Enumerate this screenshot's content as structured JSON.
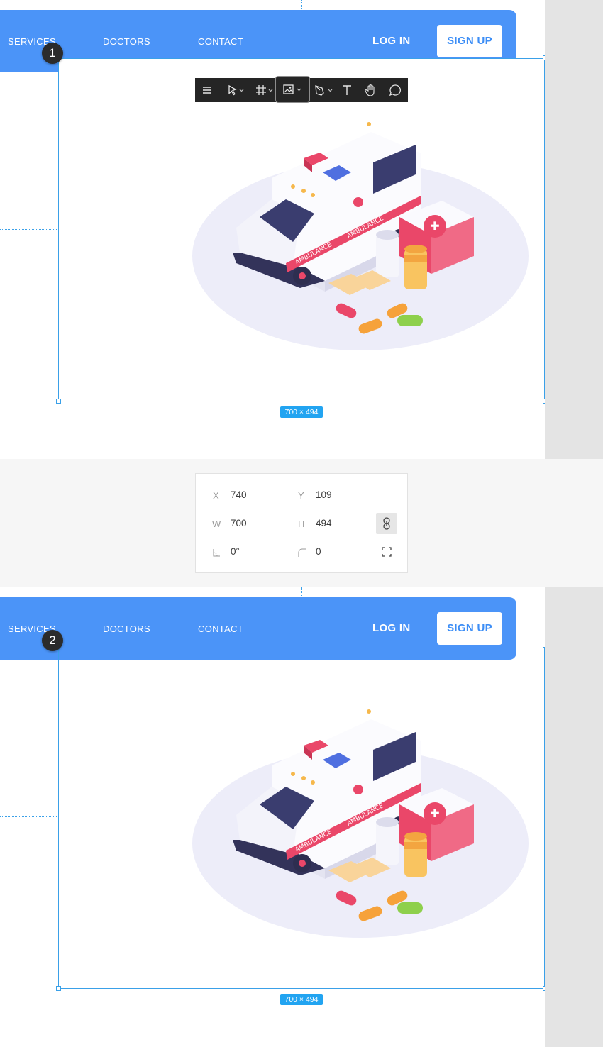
{
  "nav": {
    "links": [
      "SERVICES",
      "DOCTORS",
      "CONTACT"
    ],
    "login_label": "LOG IN",
    "signup_label": "SIGN UP"
  },
  "steps": [
    "1",
    "2"
  ],
  "frame_size_label": "700 × 494",
  "toolbar": {
    "tools": [
      "menu-icon",
      "pointer-tool-icon",
      "frame-tool-icon",
      "image-tool-icon",
      "pen-tool-icon",
      "text-tool-icon",
      "hand-tool-icon",
      "comment-tool-icon"
    ],
    "active_tool": "image-tool-icon"
  },
  "properties": {
    "x_label": "X",
    "x_value": "740",
    "y_label": "Y",
    "y_value": "109",
    "w_label": "W",
    "w_value": "700",
    "h_label": "H",
    "h_value": "494",
    "rotation_value": "0°",
    "radius_value": "0"
  },
  "illustration": {
    "ambulance_label": "AMBULANCE"
  },
  "colors": {
    "accent": "#4b94f8",
    "selection": "#3aa0e8",
    "size_badge": "#22a4f1",
    "toolbar_bg": "#252525"
  }
}
